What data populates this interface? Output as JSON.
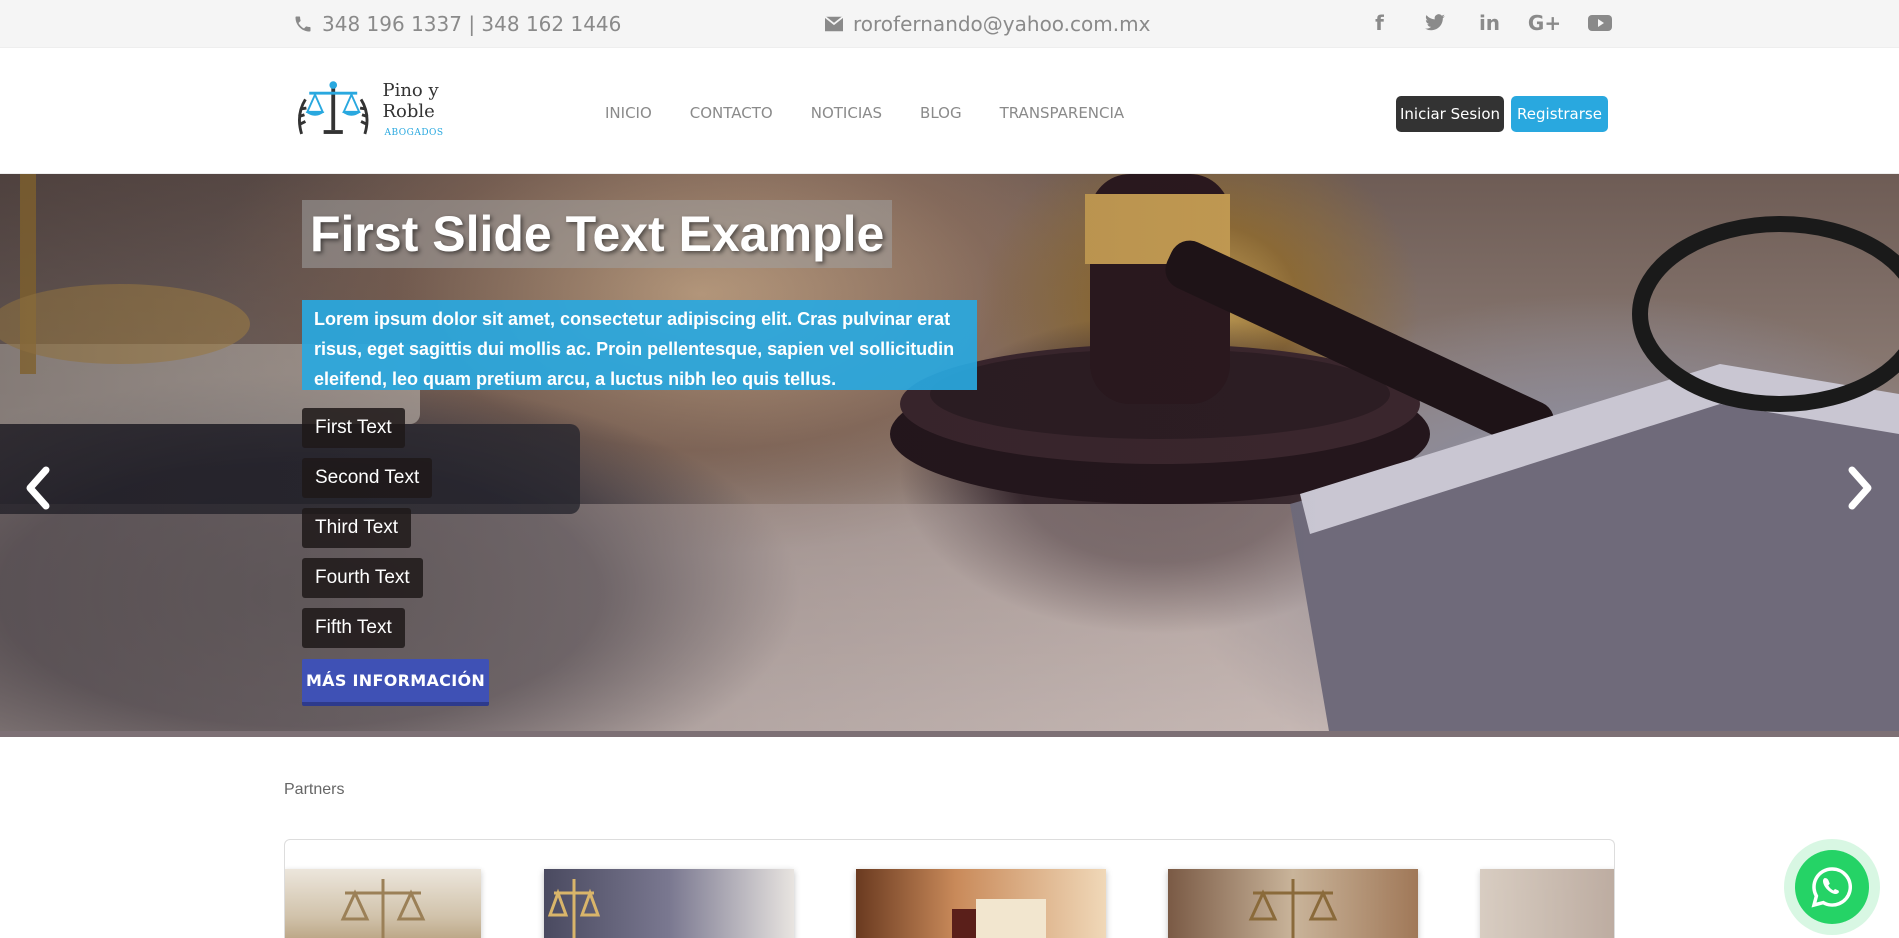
{
  "topbar": {
    "phone": "348 196 1337 | 348 162 1446",
    "email": "rorofernando@yahoo.com.mx",
    "social": [
      {
        "name": "facebook",
        "glyph": "f"
      },
      {
        "name": "twitter",
        "glyph": "t"
      },
      {
        "name": "linkedin",
        "glyph": "in"
      },
      {
        "name": "google-plus",
        "glyph": "G+"
      },
      {
        "name": "youtube",
        "glyph": "▶"
      }
    ]
  },
  "header": {
    "logo_name": "Pino y Roble",
    "logo_sub": "ABOGADOS",
    "nav": [
      "INICIO",
      "CONTACTO",
      "NOTICIAS",
      "BLOG",
      "TRANSPARENCIA"
    ],
    "login_label": "Iniciar Sesion",
    "register_label": "Registrarse"
  },
  "hero": {
    "title": "First Slide Text Example",
    "description": "Lorem ipsum dolor sit amet, consectetur adipiscing elit. Cras pulvinar erat risus, eget sagittis dui mollis ac. Proin pellentesque, sapien vel sollicitudin eleifend, leo quam pretium arcu, a luctus nibh leo quis tellus.",
    "tags": [
      "First Text",
      "Second Text",
      "Third Text",
      "Fourth Text",
      "Fifth Text"
    ],
    "cta_label": "MÁS INFORMACIÓN",
    "prev_glyph": "‹",
    "next_glyph": "›"
  },
  "partners": {
    "label": "Partners"
  },
  "colors": {
    "accent": "#29a8df",
    "dark": "#333333",
    "cta": "#3f51b5",
    "whatsapp": "#25d366"
  }
}
